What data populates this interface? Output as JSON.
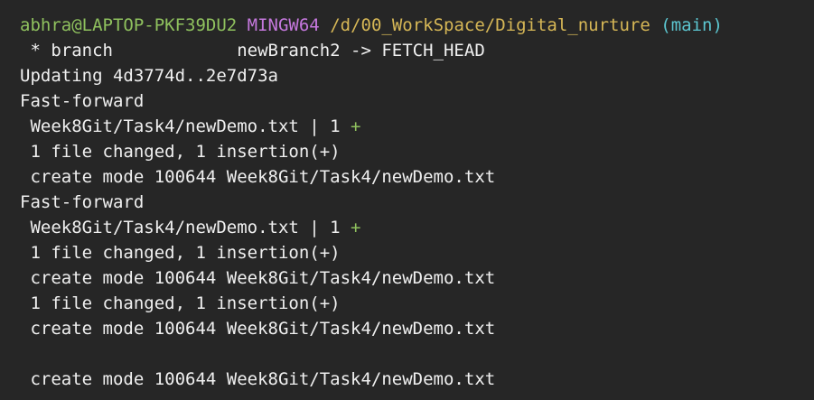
{
  "prompt": {
    "user_host": "abhra@LAPTOP-PKF39DU2",
    "system": "MINGW64",
    "path": "/d/00_WorkSpace/Digital_nurture",
    "branch": "(main)"
  },
  "colors": {
    "background": "#262626",
    "text": "#f0f0f0",
    "user_host": "#8fc15e",
    "system": "#c578dd",
    "path": "#d6b756",
    "branch": "#5cc6d0",
    "insertion": "#8fc15e"
  },
  "output": {
    "fetch": " * branch            newBranch2 -> FETCH_HEAD",
    "updating": "Updating 4d3774d..2e7d73a",
    "ff1": "Fast-forward",
    "stat1_file": " Week8Git/Task4/newDemo.txt | 1 ",
    "stat1_plus": "+",
    "summary1": " 1 file changed, 1 insertion(+)",
    "create1": " create mode 100644 Week8Git/Task4/newDemo.txt",
    "ff2": "Fast-forward",
    "stat2_file": " Week8Git/Task4/newDemo.txt | 1 ",
    "stat2_plus": "+",
    "summary2": " 1 file changed, 1 insertion(+)",
    "create2": " create mode 100644 Week8Git/Task4/newDemo.txt",
    "summary3": " 1 file changed, 1 insertion(+)",
    "create3": " create mode 100644 Week8Git/Task4/newDemo.txt",
    "create4": " create mode 100644 Week8Git/Task4/newDemo.txt"
  }
}
